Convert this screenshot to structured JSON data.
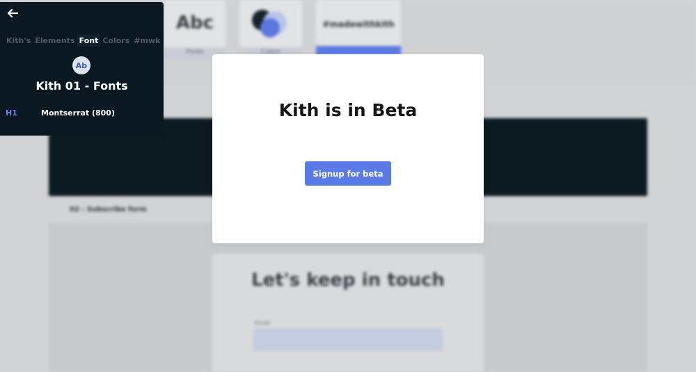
{
  "background": {
    "cards": {
      "abc": {
        "glyph": "Abc",
        "caption": "Fonts"
      },
      "colors": {
        "caption": "Colors"
      },
      "mwk": {
        "text": "#madewithkith"
      }
    },
    "section_label": "02 - Subscribe form",
    "form": {
      "title": "Let's keep in touch",
      "email_label": "Email"
    }
  },
  "panel": {
    "tabs": [
      "Kith's",
      "Elements",
      "Font",
      "Colors",
      "#mwk"
    ],
    "active_tab": "Font",
    "badge": "Ab",
    "title": "Kith 01 - Fonts",
    "font_rows": [
      {
        "tag": "H1",
        "font": "Montserrat (800)"
      }
    ]
  },
  "modal": {
    "title": "Kith is in Beta",
    "button_label": "Signup for beta"
  },
  "colors": {
    "accent": "#5a7ae6",
    "dark": "#0a1821"
  },
  "icons": {
    "back": "arrow-left-icon"
  }
}
